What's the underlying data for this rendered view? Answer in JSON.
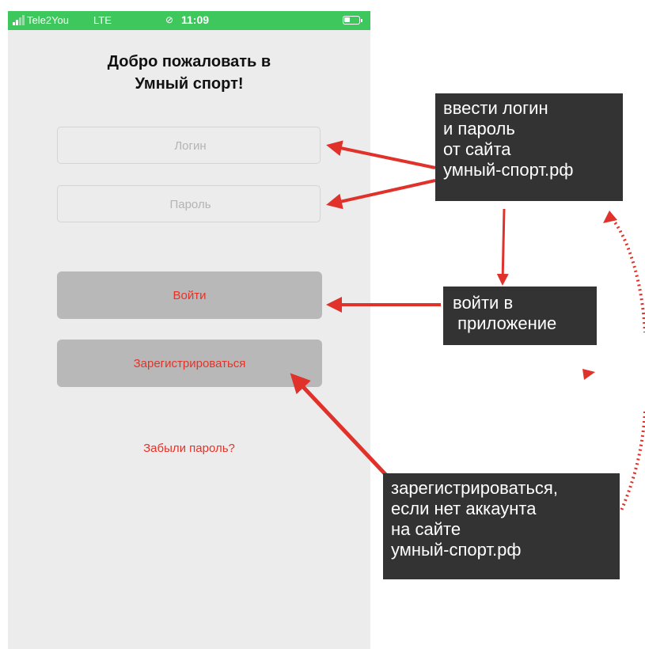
{
  "statusbar": {
    "carrier": "Tele2You",
    "network": "LTE",
    "time": "11:09",
    "icons": [
      "signal-icon",
      "orientation-lock-icon",
      "battery-icon"
    ]
  },
  "title": {
    "line1": "Добро пожаловать в",
    "line2": "Умный спорт!"
  },
  "login": {
    "placeholder": "Логин",
    "value": ""
  },
  "password": {
    "placeholder": "Пароль",
    "value": ""
  },
  "buttons": {
    "login": "Войти",
    "register": "Зарегистрироваться"
  },
  "forgot_link": "Забыли пароль?",
  "annotations": {
    "credentials": [
      "ввести логин",
      "и пароль",
      "от сайта",
      "умный-спорт.рф"
    ],
    "enter": [
      "войти в",
      " приложение"
    ],
    "register": [
      "зарегистрироваться,",
      "если нет аккаунта",
      "на сайте",
      "умный-спорт.рф"
    ]
  },
  "colors": {
    "status_bar": "#3ec75d",
    "screen_bg": "#ececec",
    "button_bg": "#b8b8b8",
    "accent_red": "#e53228",
    "note_bg": "#333333",
    "arrow": "#e0322a"
  }
}
